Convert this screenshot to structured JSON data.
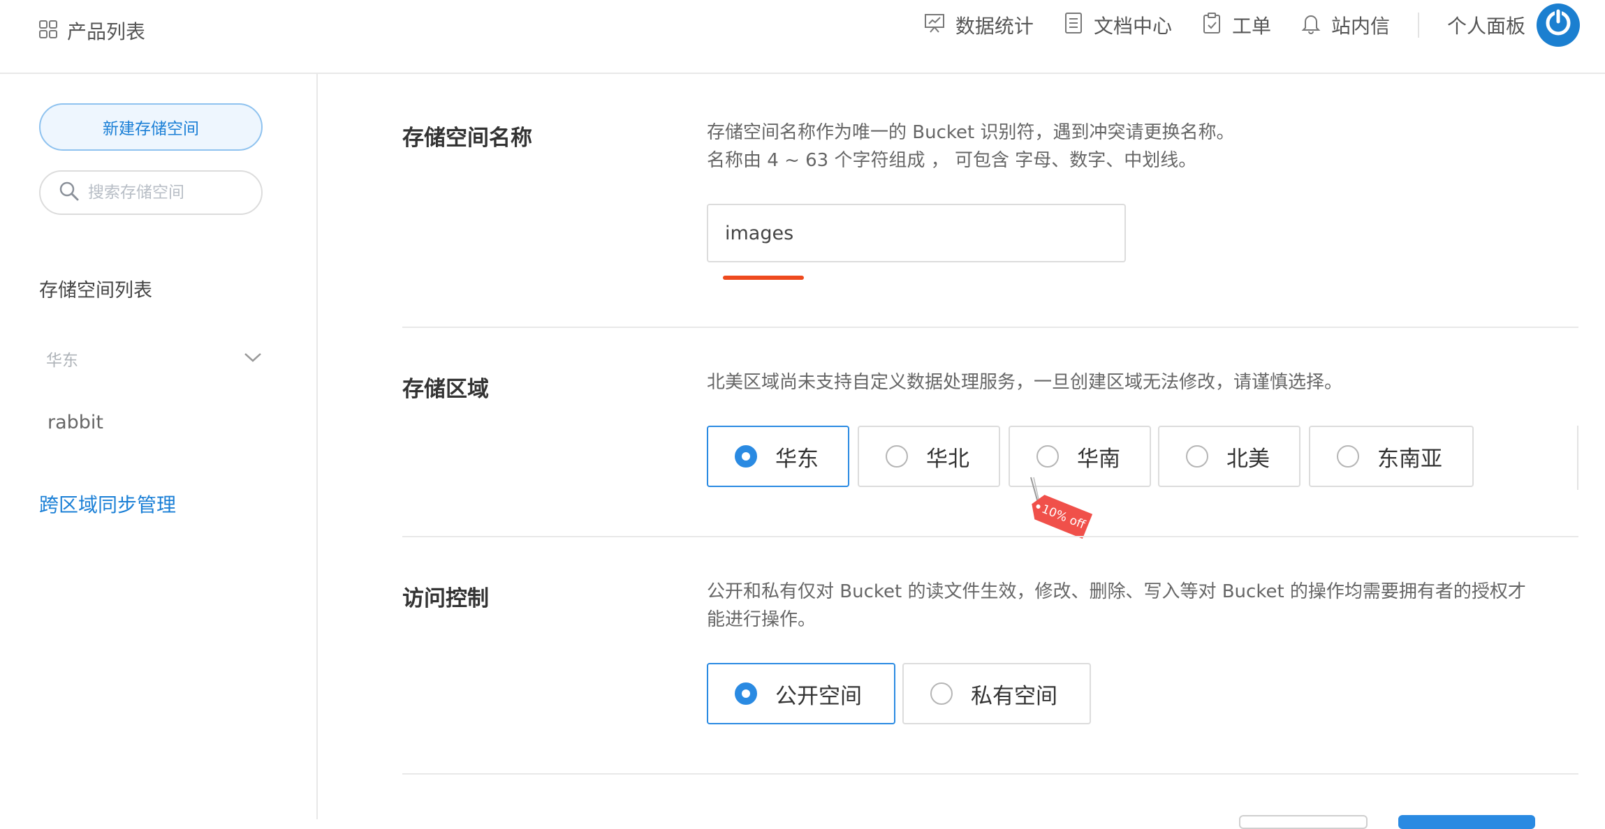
{
  "header": {
    "product_list_label": "产品列表",
    "nav": [
      {
        "label": "数据统计",
        "icon": "presentation-chart-icon"
      },
      {
        "label": "文档中心",
        "icon": "document-icon"
      },
      {
        "label": "工单",
        "icon": "clipboard-icon"
      },
      {
        "label": "站内信",
        "icon": "bell-icon"
      }
    ],
    "profile_label": "个人面板",
    "avatar_color": "#1b7fd0"
  },
  "sidebar": {
    "new_bucket_label": "新建存储空间",
    "search_placeholder": "搜索存储空间",
    "list_title": "存储空间列表",
    "region_value": "华东",
    "buckets": [
      "rabbit"
    ],
    "sync_link": "跨区域同步管理"
  },
  "form": {
    "name_section": {
      "label": "存储空间名称",
      "desc_line1": "存储空间名称作为唯一的 Bucket 识别符，遇到冲突请更换名称。",
      "desc_line2": "名称由 4 ~ 63 个字符组成 ， 可包含 字母、数字、中划线。",
      "value": "images"
    },
    "region_section": {
      "label": "存储区域",
      "desc": "北美区域尚未支持自定义数据处理服务，一旦创建区域无法修改，请谨慎选择。",
      "options": [
        "华东",
        "华北",
        "华南",
        "北美",
        "东南亚"
      ],
      "selected": "华东",
      "discount_tag": "10% off"
    },
    "access_section": {
      "label": "访问控制",
      "desc_line1": "公开和私有仅对 Bucket 的读文件生效，修改、删除、写入等对 Bucket 的操作均需要拥有者的授权才",
      "desc_line2": "能进行操作。",
      "options": [
        "公开空间",
        "私有空间"
      ],
      "selected": "公开空间"
    }
  },
  "colors": {
    "primary": "#2a8ae2",
    "link": "#1a7fd6",
    "error_underline": "#ee4a1e",
    "tag": "#f0504a"
  }
}
